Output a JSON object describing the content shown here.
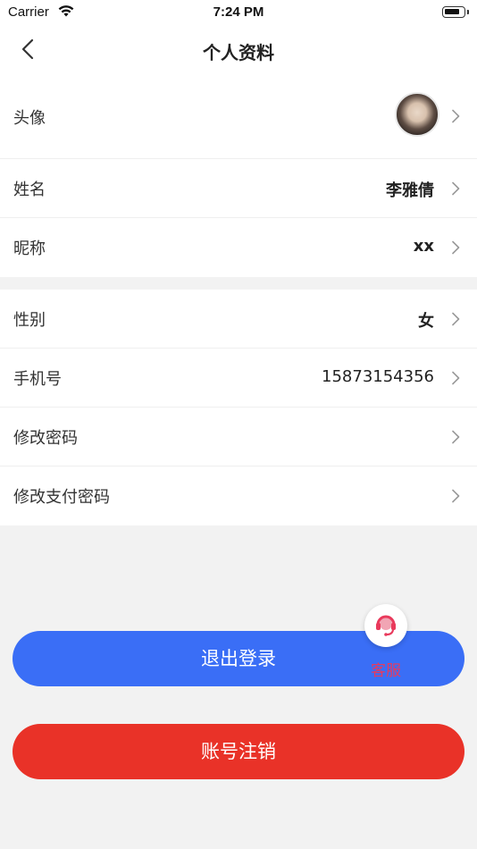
{
  "status_bar": {
    "carrier": "Carrier",
    "time": "7:24 PM",
    "battery_level": 0.85
  },
  "nav": {
    "title": "个人资料"
  },
  "profile": {
    "avatar_label": "头像",
    "name_label": "姓名",
    "name_value": "李雅倩",
    "nickname_label": "昵称",
    "nickname_value": "xx"
  },
  "account": {
    "gender_label": "性别",
    "gender_value": "女",
    "phone_label": "手机号",
    "phone_value": "15873154356",
    "change_password_label": "修改密码",
    "change_pay_password_label": "修改支付密码"
  },
  "buttons": {
    "logout": "退出登录",
    "deregister": "账号注销"
  },
  "customer_service": {
    "label": "客服",
    "icon": "headset-icon"
  },
  "colors": {
    "logout_bg": "#3a6ef6",
    "deregister_bg": "#e93228",
    "cs_label": "#e93a5c",
    "page_bg": "#f2f2f2"
  }
}
